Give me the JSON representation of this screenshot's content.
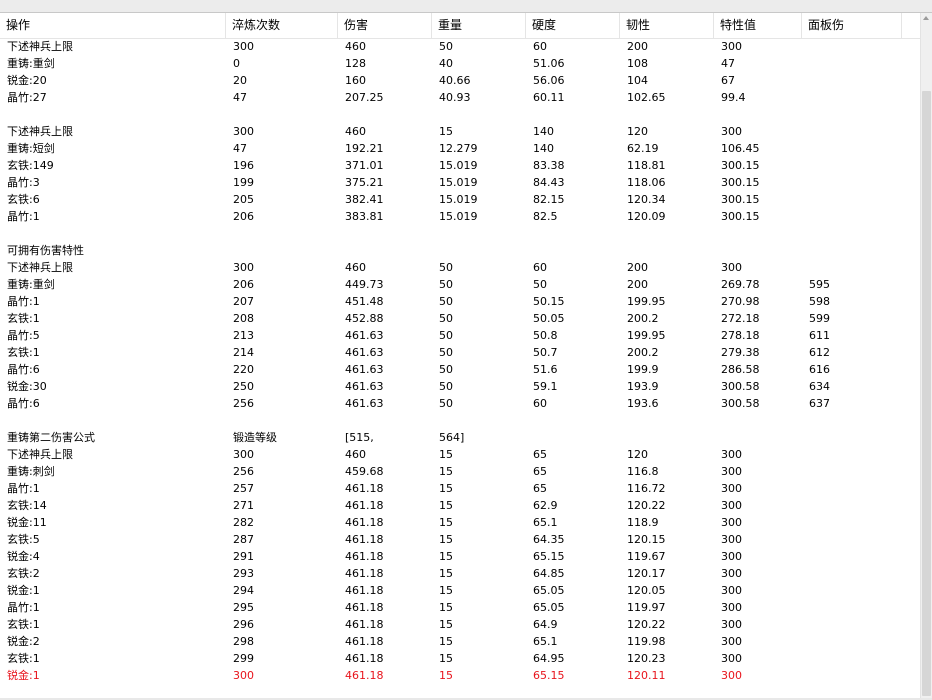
{
  "columns": [
    "操作",
    "淬炼次数",
    "伤害",
    "重量",
    "硬度",
    "韧性",
    "特性值",
    "面板伤"
  ],
  "rows": [
    [
      "下述神兵上限",
      "300",
      "460",
      "50",
      "60",
      "200",
      "300",
      ""
    ],
    [
      "重铸:重剑",
      "0",
      "128",
      "40",
      "51.06",
      "108",
      "47",
      ""
    ],
    [
      "锐金:20",
      "20",
      "160",
      "40.66",
      "56.06",
      "104",
      "67",
      ""
    ],
    [
      "晶竹:27",
      "47",
      "207.25",
      "40.93",
      "60.11",
      "102.65",
      "99.4",
      ""
    ],
    [
      "",
      "",
      "",
      "",
      "",
      "",
      "",
      ""
    ],
    [
      "下述神兵上限",
      "300",
      "460",
      "15",
      "140",
      "120",
      "300",
      ""
    ],
    [
      "重铸:短剑",
      "47",
      "192.21",
      "12.279",
      "140",
      "62.19",
      "106.45",
      ""
    ],
    [
      "玄铁:149",
      "196",
      "371.01",
      "15.019",
      "83.38",
      "118.81",
      "300.15",
      ""
    ],
    [
      "晶竹:3",
      "199",
      "375.21",
      "15.019",
      "84.43",
      "118.06",
      "300.15",
      ""
    ],
    [
      "玄铁:6",
      "205",
      "382.41",
      "15.019",
      "82.15",
      "120.34",
      "300.15",
      ""
    ],
    [
      "晶竹:1",
      "206",
      "383.81",
      "15.019",
      "82.5",
      "120.09",
      "300.15",
      ""
    ],
    [
      "",
      "",
      "",
      "",
      "",
      "",
      "",
      ""
    ],
    [
      "可拥有伤害特性",
      "",
      "",
      "",
      "",
      "",
      "",
      ""
    ],
    [
      "下述神兵上限",
      "300",
      "460",
      "50",
      "60",
      "200",
      "300",
      ""
    ],
    [
      "重铸:重剑",
      "206",
      "449.73",
      "50",
      "50",
      "200",
      "269.78",
      "595"
    ],
    [
      "晶竹:1",
      "207",
      "451.48",
      "50",
      "50.15",
      "199.95",
      "270.98",
      "598"
    ],
    [
      "玄铁:1",
      "208",
      "452.88",
      "50",
      "50.05",
      "200.2",
      "272.18",
      "599"
    ],
    [
      "晶竹:5",
      "213",
      "461.63",
      "50",
      "50.8",
      "199.95",
      "278.18",
      "611"
    ],
    [
      "玄铁:1",
      "214",
      "461.63",
      "50",
      "50.7",
      "200.2",
      "279.38",
      "612"
    ],
    [
      "晶竹:6",
      "220",
      "461.63",
      "50",
      "51.6",
      "199.9",
      "286.58",
      "616"
    ],
    [
      "锐金:30",
      "250",
      "461.63",
      "50",
      "59.1",
      "193.9",
      "300.58",
      "634"
    ],
    [
      "晶竹:6",
      "256",
      "461.63",
      "50",
      "60",
      "193.6",
      "300.58",
      "637"
    ],
    [
      "",
      "",
      "",
      "",
      "",
      "",
      "",
      ""
    ],
    [
      "重铸第二伤害公式",
      "锻造等级",
      "[515,",
      "564]",
      "",
      "",
      "",
      ""
    ],
    [
      "下述神兵上限",
      "300",
      "460",
      "15",
      "65",
      "120",
      "300",
      ""
    ],
    [
      "重铸:刺剑",
      "256",
      "459.68",
      "15",
      "65",
      "116.8",
      "300",
      ""
    ],
    [
      "晶竹:1",
      "257",
      "461.18",
      "15",
      "65",
      "116.72",
      "300",
      ""
    ],
    [
      "玄铁:14",
      "271",
      "461.18",
      "15",
      "62.9",
      "120.22",
      "300",
      ""
    ],
    [
      "锐金:11",
      "282",
      "461.18",
      "15",
      "65.1",
      "118.9",
      "300",
      ""
    ],
    [
      "玄铁:5",
      "287",
      "461.18",
      "15",
      "64.35",
      "120.15",
      "300",
      ""
    ],
    [
      "锐金:4",
      "291",
      "461.18",
      "15",
      "65.15",
      "119.67",
      "300",
      ""
    ],
    [
      "玄铁:2",
      "293",
      "461.18",
      "15",
      "64.85",
      "120.17",
      "300",
      ""
    ],
    [
      "锐金:1",
      "294",
      "461.18",
      "15",
      "65.05",
      "120.05",
      "300",
      ""
    ],
    [
      "晶竹:1",
      "295",
      "461.18",
      "15",
      "65.05",
      "119.97",
      "300",
      ""
    ],
    [
      "玄铁:1",
      "296",
      "461.18",
      "15",
      "64.9",
      "120.22",
      "300",
      ""
    ],
    [
      "锐金:2",
      "298",
      "461.18",
      "15",
      "65.1",
      "119.98",
      "300",
      ""
    ],
    [
      "玄铁:1",
      "299",
      "461.18",
      "15",
      "64.95",
      "120.23",
      "300",
      ""
    ],
    [
      "锐金:1",
      "300",
      "461.18",
      "15",
      "65.15",
      "120.11",
      "300",
      ""
    ]
  ],
  "highlight_row": 37,
  "highlight_color": "#e8141c"
}
